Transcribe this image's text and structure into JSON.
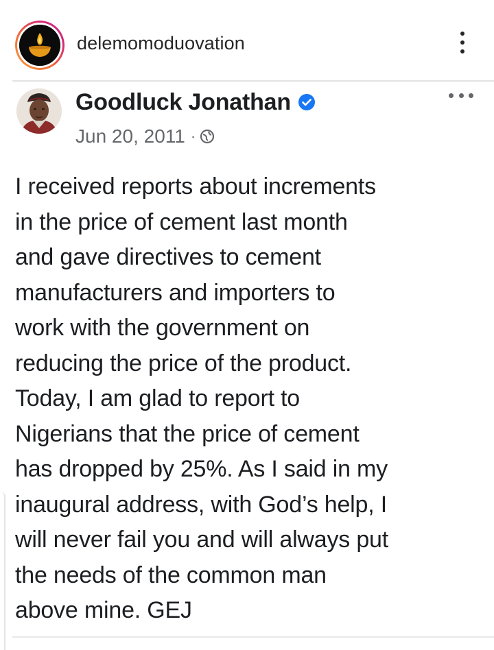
{
  "instagram": {
    "username": "delemomoduovation",
    "avatar_icon": "oil-lamp-icon",
    "more_icon": "vertical-ellipsis-icon"
  },
  "post": {
    "author": "Goodluck Jonathan",
    "verified_icon": "verified-badge-icon",
    "date": "Jun 20, 2011",
    "separator": "·",
    "privacy_icon": "globe-icon",
    "more_icon": "horizontal-ellipsis-icon",
    "body_lines": [
      "I received reports about increments",
      "in the price of cement last month",
      "and gave directives to cement",
      "manufacturers and importers to",
      "work with the government on",
      "reducing the price of the product.",
      "Today, I am glad to report to",
      "Nigerians that the price of cement",
      "has dropped by 25%. As I said in my",
      "inaugural address, with God’s help, I",
      "will never fail you and will always put",
      "the needs of the common man",
      "above mine. GEJ"
    ]
  },
  "colors": {
    "verified_blue": "#1877f2",
    "meta_gray": "#65676b",
    "text": "#1c1e21"
  }
}
